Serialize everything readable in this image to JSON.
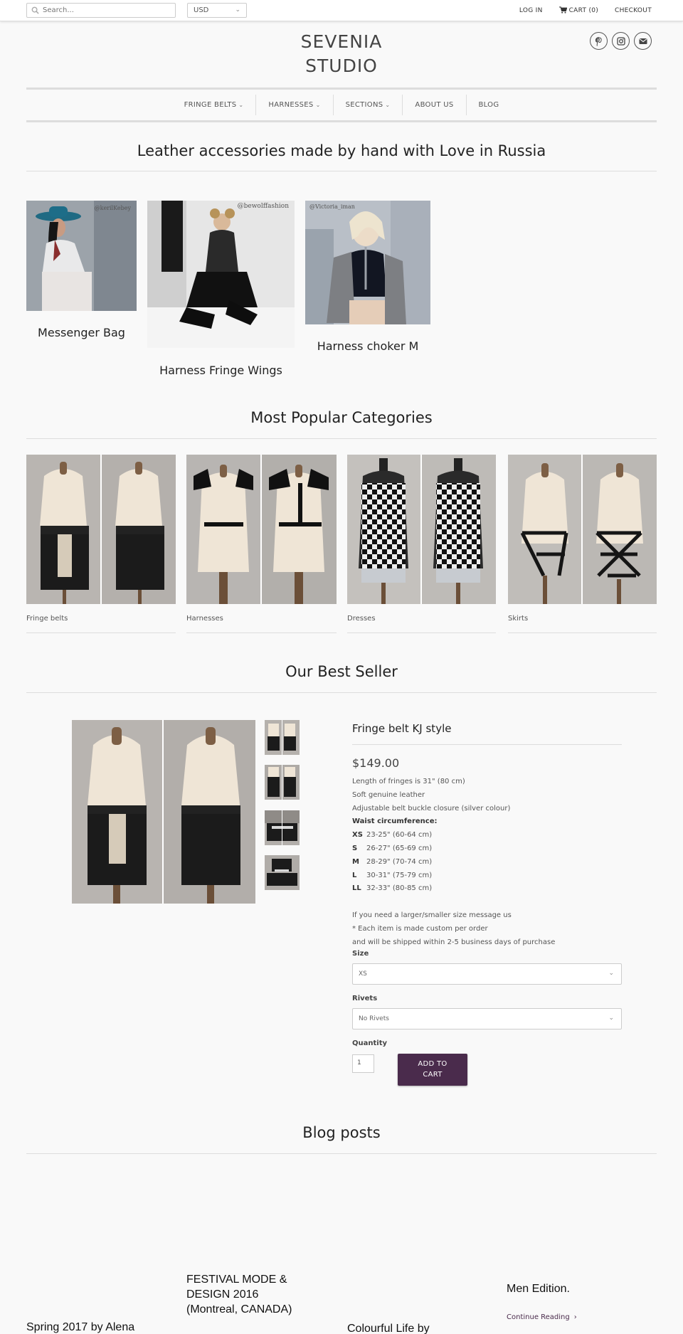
{
  "topbar": {
    "search_placeholder": "Search...",
    "currency": "USD",
    "login": "LOG IN",
    "cart": "CART (0)",
    "checkout": "CHECKOUT"
  },
  "header": {
    "logo_line1": "SEVENIA",
    "logo_line2": "STUDIO",
    "socials": [
      "pinterest-icon",
      "instagram-icon",
      "email-icon"
    ]
  },
  "nav": {
    "items": [
      {
        "label": "FRINGE BELTS",
        "dropdown": true
      },
      {
        "label": "HARNESSES",
        "dropdown": true
      },
      {
        "label": "SECTIONS",
        "dropdown": true
      },
      {
        "label": "ABOUT US",
        "dropdown": false
      },
      {
        "label": "BLOG",
        "dropdown": false
      }
    ]
  },
  "hero": {
    "heading": "Leather accessories made by hand with Love in Russia",
    "products": [
      {
        "title": "Messenger Bag",
        "handle": "@kerilKebey"
      },
      {
        "title": "Harness Fringe Wings",
        "handle": "@bewolffashion"
      },
      {
        "title": "Harness choker M",
        "handle": "@Victoria_iman"
      }
    ]
  },
  "categories": {
    "heading": "Most Popular Categories",
    "items": [
      {
        "label": "Fringe belts"
      },
      {
        "label": "Harnesses"
      },
      {
        "label": "Dresses"
      },
      {
        "label": "Skirts"
      }
    ]
  },
  "best_seller": {
    "heading": "Our Best Seller",
    "title": "Fringe belt KJ style",
    "price": "$149.00",
    "desc": [
      "Length of fringes is 31\" (80 cm)",
      "Soft genuine leather",
      "Adjustable belt buckle closure (silver colour)"
    ],
    "waist_heading": "Waist circumference:",
    "sizes": [
      {
        "code": "XS",
        "value": "23-25\" (60-64 cm)"
      },
      {
        "code": "S",
        "value": "26-27\" (65-69 cm)"
      },
      {
        "code": "M",
        "value": "28-29\" (70-74 cm)"
      },
      {
        "code": "L",
        "value": "30-31\" (75-79 cm)"
      },
      {
        "code": "LL",
        "value": "32-33\" (80-85 cm)"
      }
    ],
    "notes": [
      "If you need a larger/smaller size message us",
      "* Each item is made custom per order",
      "and will be shipped within 2-5 business days of purchase"
    ],
    "size_label": "Size",
    "size_value": "XS",
    "rivets_label": "Rivets",
    "rivets_value": "No Rivets",
    "quantity_label": "Quantity",
    "quantity_value": "1",
    "add_line1": "ADD TO",
    "add_line2": "CART"
  },
  "blog": {
    "heading": "Blog posts",
    "posts": [
      {
        "title": "Spring 2017 by Alena"
      },
      {
        "title": "FESTIVAL MODE & DESIGN 2016 (Montreal, CANADA)"
      },
      {
        "title": "Colourful Life by"
      },
      {
        "title": "Men Edition."
      }
    ],
    "continue": "Continue Reading"
  },
  "colors": {
    "accent": "#4a2b4c",
    "background": "#f9f9f9"
  }
}
